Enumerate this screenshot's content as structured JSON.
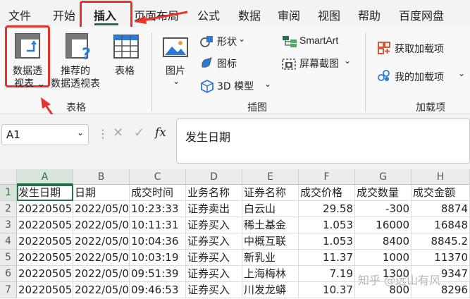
{
  "tabs": [
    "文件",
    "开始",
    "插入",
    "页面布局",
    "公式",
    "数据",
    "审阅",
    "视图",
    "帮助",
    "百度网盘"
  ],
  "ribbon": {
    "pivot_label1": "数据透",
    "pivot_label2": "视表 ⌄",
    "rec_label1": "推荐的",
    "rec_label2": "数据透视表",
    "table_label": "表格",
    "group_tables": "表格",
    "picture_label": "图片",
    "shapes_label": "形状",
    "icons_label": "图标",
    "model_label": "3D 模型",
    "smartart_label": "SmartArt",
    "screenshot_label": "屏幕截图",
    "group_illustrations": "插图",
    "get_addins_label": "获取加载项",
    "my_addins_label": "我的加载项",
    "group_addins": "加载项"
  },
  "formula_bar": {
    "name_box": "A1",
    "fx": "fx",
    "content": "发生日期"
  },
  "grid": {
    "columns": [
      "A",
      "B",
      "C",
      "D",
      "E",
      "F",
      "G",
      "H"
    ],
    "row_numbers": [
      "1",
      "2",
      "3",
      "4",
      "5",
      "6",
      "7"
    ],
    "header": [
      "发生日期",
      "日期",
      "成交时间",
      "业务名称",
      "证券名称",
      "成交价格",
      "成交数量",
      "成交金额"
    ],
    "rows": [
      [
        "20220505",
        "2022/05/0",
        "10:23:33",
        "证券卖出",
        "白云山",
        "29.58",
        "-300",
        "8874"
      ],
      [
        "20220505",
        "2022/05/0",
        "10:11:31",
        "证券买入",
        "稀土基金",
        "1.053",
        "16000",
        "16848"
      ],
      [
        "20220505",
        "2022/05/0",
        "10:04:36",
        "证券买入",
        "中概互联",
        "1.053",
        "8400",
        "8845.2"
      ],
      [
        "20220505",
        "2022/05/0",
        "10:03:19",
        "证券买入",
        "新乳业",
        "11.37",
        "1000",
        "11370"
      ],
      [
        "20220505",
        "2022/05/0",
        "09:51:39",
        "证券买入",
        "上海梅林",
        "7.19",
        "1300",
        "9347"
      ],
      [
        "20220505",
        "2022/05/0",
        "09:46:53",
        "证券买入",
        "川发龙蟒",
        "10.37",
        "800",
        "8296"
      ]
    ]
  },
  "watermark": "知乎 @远山有风",
  "colors": {
    "accent": "#217346",
    "highlight": "#e8322e"
  }
}
